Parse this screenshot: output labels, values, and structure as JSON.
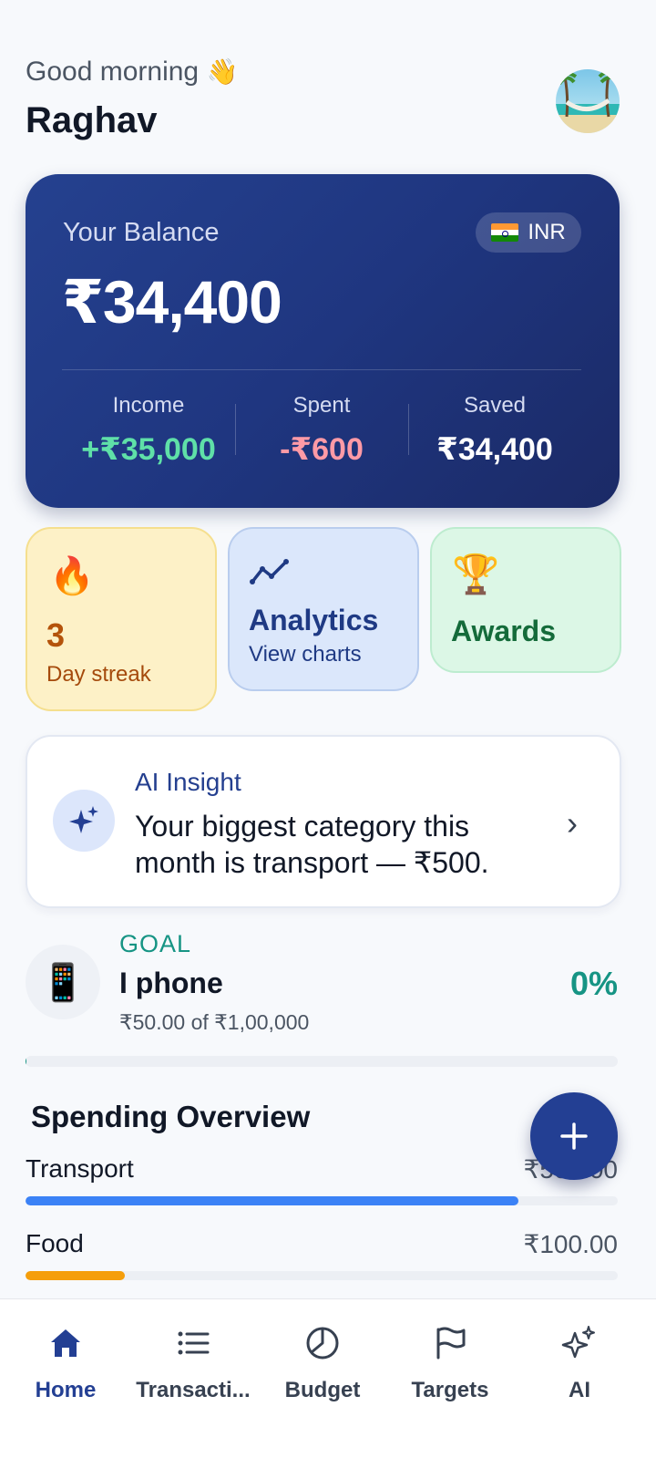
{
  "header": {
    "greeting": "Good morning",
    "greeting_emoji": "👋",
    "user_name": "Raghav",
    "avatar_icon": "beach-hammock-avatar"
  },
  "balance_card": {
    "label": "Your Balance",
    "currency": "INR",
    "currency_flag_icon": "india-flag-icon",
    "amount": "₹34,400",
    "stats": {
      "income": {
        "label": "Income",
        "value": "+₹35,000"
      },
      "spent": {
        "label": "Spent",
        "value": "-₹600"
      },
      "saved": {
        "label": "Saved",
        "value": "₹34,400"
      }
    },
    "colors": {
      "bg_start": "#25418f",
      "bg_end": "#1b2a66",
      "income": "#5fe0a8",
      "spent": "#ff9aa6"
    }
  },
  "tiles": {
    "streak": {
      "emoji": "🔥",
      "count": "3",
      "label": "Day streak"
    },
    "analytics": {
      "icon": "trend-line-icon",
      "title": "Analytics",
      "subtitle": "View charts"
    },
    "awards": {
      "emoji": "🏆",
      "title": "Awards"
    }
  },
  "ai_insight": {
    "icon": "sparkles-icon",
    "title": "AI Insight",
    "text": "Your biggest category this month is transport — ₹500.",
    "chevron": "›"
  },
  "goal": {
    "emoji": "📱",
    "tag": "GOAL",
    "name": "I phone",
    "progress_text": "₹50.00 of ₹1,00,000",
    "percent": "0%",
    "progress_fraction": 0.0005,
    "color": "#169484"
  },
  "spending_overview": {
    "title": "Spending Overview",
    "categories": [
      {
        "name": "Transport",
        "amount": "₹500.00",
        "fraction": 0.833,
        "color": "#3b82f6"
      },
      {
        "name": "Food",
        "amount": "₹100.00",
        "fraction": 0.167,
        "color": "#f59e0b"
      }
    ]
  },
  "fab": {
    "icon": "plus-icon"
  },
  "bottom_nav": {
    "items": [
      {
        "label": "Home",
        "icon": "home-icon",
        "active": true
      },
      {
        "label": "Transacti...",
        "icon": "list-icon",
        "active": false
      },
      {
        "label": "Budget",
        "icon": "pie-chart-icon",
        "active": false
      },
      {
        "label": "Targets",
        "icon": "flag-icon",
        "active": false
      },
      {
        "label": "AI",
        "icon": "sparkles-icon",
        "active": false
      }
    ],
    "active_color": "#233f93"
  }
}
